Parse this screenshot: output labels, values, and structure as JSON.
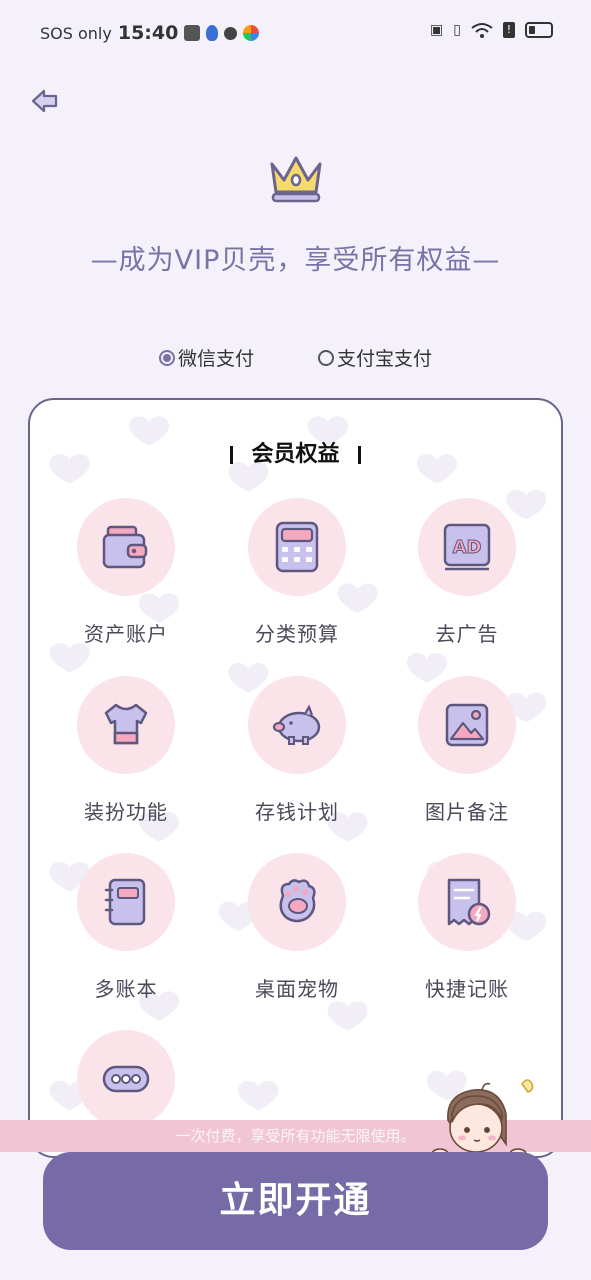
{
  "status": {
    "carrier": "SOS only",
    "time": "15:40",
    "battery_icon": "battery-icon"
  },
  "header": {
    "headline": "—成为VIP贝壳，享受所有权益—"
  },
  "payment": {
    "options": [
      {
        "label": "微信支付",
        "selected": true
      },
      {
        "label": "支付宝支付",
        "selected": false
      }
    ]
  },
  "benefits": {
    "title": "会员权益",
    "items": [
      {
        "label": "资产账户",
        "icon": "wallet-icon"
      },
      {
        "label": "分类预算",
        "icon": "calculator-icon"
      },
      {
        "label": "去广告",
        "icon": "ad-icon"
      },
      {
        "label": "装扮功能",
        "icon": "tshirt-icon"
      },
      {
        "label": "存钱计划",
        "icon": "piggy-bank-icon"
      },
      {
        "label": "图片备注",
        "icon": "image-icon"
      },
      {
        "label": "多账本",
        "icon": "notebook-icon"
      },
      {
        "label": "桌面宠物",
        "icon": "paw-icon"
      },
      {
        "label": "快捷记账",
        "icon": "receipt-lightning-icon"
      },
      {
        "label": "",
        "icon": "more-dots-icon"
      }
    ]
  },
  "banner": {
    "text": "一次付费，享受所有功能无限使用。"
  },
  "cta": {
    "label": "立即开通"
  },
  "colors": {
    "accent": "#766ba6",
    "icon_bg": "#fbe3ea",
    "banner": "#f1c5d3"
  }
}
